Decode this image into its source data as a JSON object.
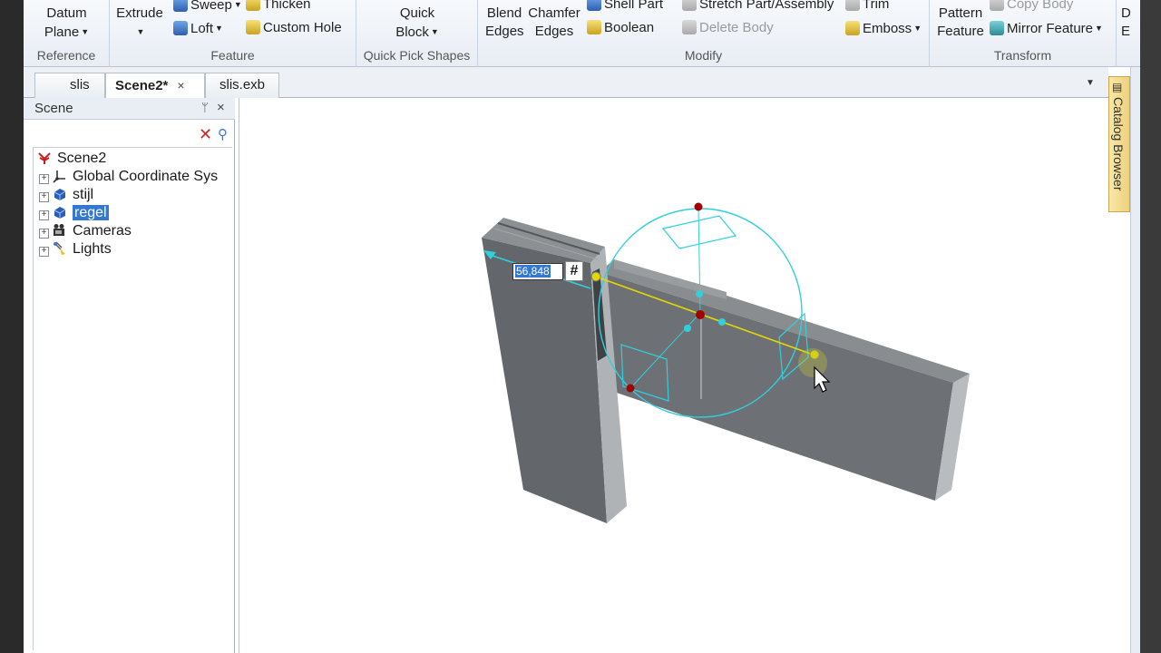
{
  "ribbon": {
    "reference": {
      "label": "Reference",
      "datum_plane_line1": "Datum",
      "datum_plane_line2": "Plane"
    },
    "feature": {
      "label": "Feature",
      "extrude": "Extrude",
      "sweep": "Sweep",
      "loft": "Loft",
      "thicken": "Thicken",
      "custom_hole": "Custom Hole"
    },
    "quick_pick": {
      "label": "Quick Pick Shapes",
      "quick_block_line1": "Quick",
      "quick_block_line2": "Block"
    },
    "modify": {
      "label": "Modify",
      "blend_line1": "Blend",
      "blend_line2": "Edges",
      "chamfer_line1": "Chamfer",
      "chamfer_line2": "Edges",
      "shell_part": "Shell Part",
      "boolean": "Boolean",
      "stretch": "Stretch Part/Assembly",
      "delete_body": "Delete Body",
      "trim": "Trim",
      "emboss": "Emboss"
    },
    "transform": {
      "label": "Transform",
      "pattern_line1": "Pattern",
      "pattern_line2": "Feature",
      "copy_body": "Copy Body",
      "mirror_feature": "Mirror Feature"
    },
    "cut_off_line1": "D",
    "cut_off_line2": "E"
  },
  "tabs": [
    {
      "label": "slis"
    },
    {
      "label": "Scene2*",
      "close": "×"
    },
    {
      "label": "slis.exb"
    }
  ],
  "scene_panel": {
    "title": "Scene",
    "pin": "ᛘ",
    "close": "×",
    "tree": [
      {
        "label": "Scene2"
      },
      {
        "label": "Global Coordinate Sys",
        "toggle": "+"
      },
      {
        "label": "stijl",
        "toggle": "+"
      },
      {
        "label": "regel",
        "toggle": "+"
      },
      {
        "label": "Cameras",
        "toggle": "+"
      },
      {
        "label": "Lights",
        "toggle": "+"
      }
    ]
  },
  "viewport": {
    "dimension_value": "56,848",
    "dimension_hash": "#"
  },
  "catalog_browser": {
    "label": "Catalog Browser"
  },
  "colors": {
    "selection": "#3478d4",
    "handle_cyan": "#2fd0dc",
    "axis_yellow": "#e3d800",
    "handle_red": "#a00000",
    "body_gray": "#707478"
  }
}
